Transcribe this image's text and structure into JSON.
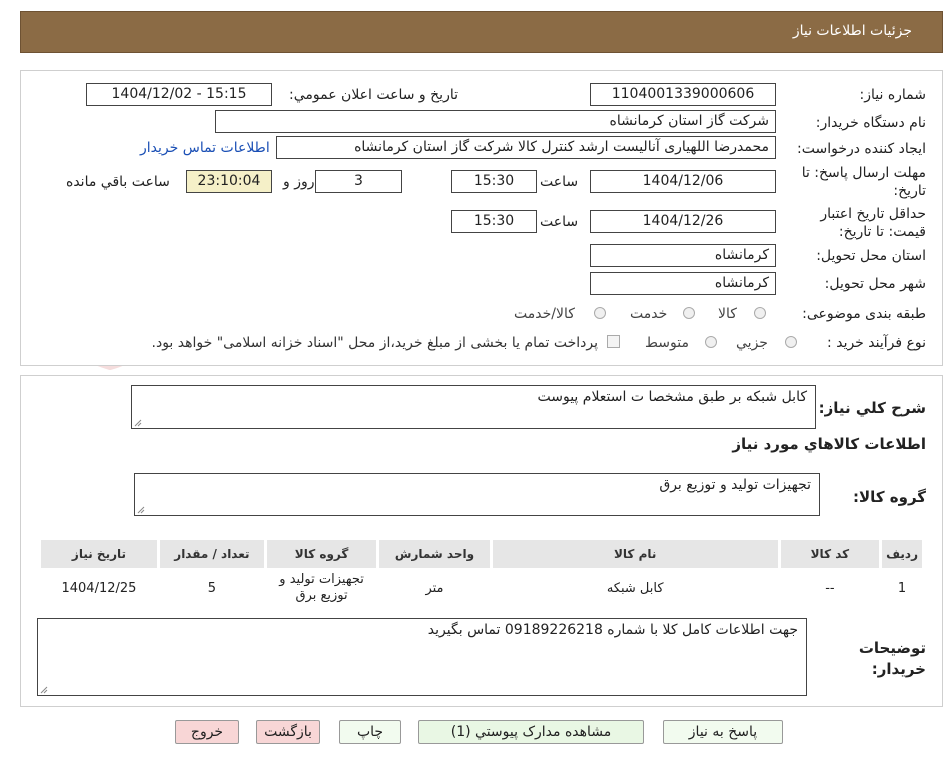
{
  "header": {
    "title": "جزئیات اطلاعات نیاز"
  },
  "form": {
    "need_number_label": "شماره نیاز:",
    "need_number": "1104001339000606",
    "announce_label": "تاریخ و ساعت اعلان عمومي:",
    "announce_value": "1404/12/02 - 15:15",
    "buyer_org_label": "نام دستگاه خريدار:",
    "buyer_org": "شرکت گاز استان کرمانشاه",
    "requester_label": "ايجاد کننده درخواست:",
    "requester": "محمدرضا اللهیاری آنالیست ارشد کنترل کالا شرکت گاز استان کرمانشاه",
    "contact_link": "اطلاعات تماس خريدار",
    "deadline_label": "مهلت ارسال پاسخ: تا تاريخ:",
    "deadline_date": "1404/12/06",
    "time_label": "ساعت",
    "deadline_time": "15:30",
    "remaining_days": "3",
    "day_and_label": "روز و",
    "remaining_time": "23:10:04",
    "remaining_label": "ساعت باقي مانده",
    "validity_label": "حداقل تاريخ اعتبار قيمت: تا تاريخ:",
    "validity_date": "1404/12/26",
    "validity_time": "15:30",
    "province_label": "استان محل تحويل:",
    "province": "کرمانشاه",
    "city_label": "شهر محل تحويل:",
    "city": "کرمانشاه",
    "category_label": "طبقه بندی موضوعی:",
    "category_options": [
      "کالا",
      "خدمت",
      "کالا/خدمت"
    ],
    "process_label": "نوع فرآيند خريد :",
    "process_options": [
      "جزيي",
      "متوسط"
    ],
    "payment_note": "پرداخت تمام یا بخشی از مبلغ خرید،از محل \"اسناد خزانه اسلامی\" خواهد بود."
  },
  "summary": {
    "desc_label": "شرح کلي نياز:",
    "desc_value": "کابل شبکه بر طبق مشخصا ت استعلام پیوست",
    "goods_info_title": "اطلاعات کالاهاي مورد نياز",
    "goods_group_label": "گروه کالا:",
    "goods_group_value": "تجهیزات تولید و توزیع برق"
  },
  "table": {
    "headers": [
      "رديف",
      "کد کالا",
      "نام کالا",
      "واحد شمارش",
      "گروه کالا",
      "تعداد / مقدار",
      "تاريخ نياز"
    ],
    "rows": [
      [
        "1",
        "--",
        "کابل شبکه",
        "متر",
        "تجهیزات تولید و توزیع برق",
        "5",
        "1404/12/25"
      ]
    ]
  },
  "buyer_notes": {
    "label": "توضيحات خريدار:",
    "value": "جهت اطلاعات کامل کلا با شماره 09189226218 تماس بگیرید"
  },
  "buttons": {
    "reply": "پاسخ به نياز",
    "attachments": "مشاهده مدارک پيوستي (1)",
    "print": "چاپ",
    "back": "بازگشت",
    "exit": "خروج"
  },
  "watermark": {
    "text": "AriaTender.neT"
  },
  "colors": {
    "header_bg": "#8b6b45",
    "link": "#1a4fb5",
    "timer_bg": "#f5f0c8"
  }
}
